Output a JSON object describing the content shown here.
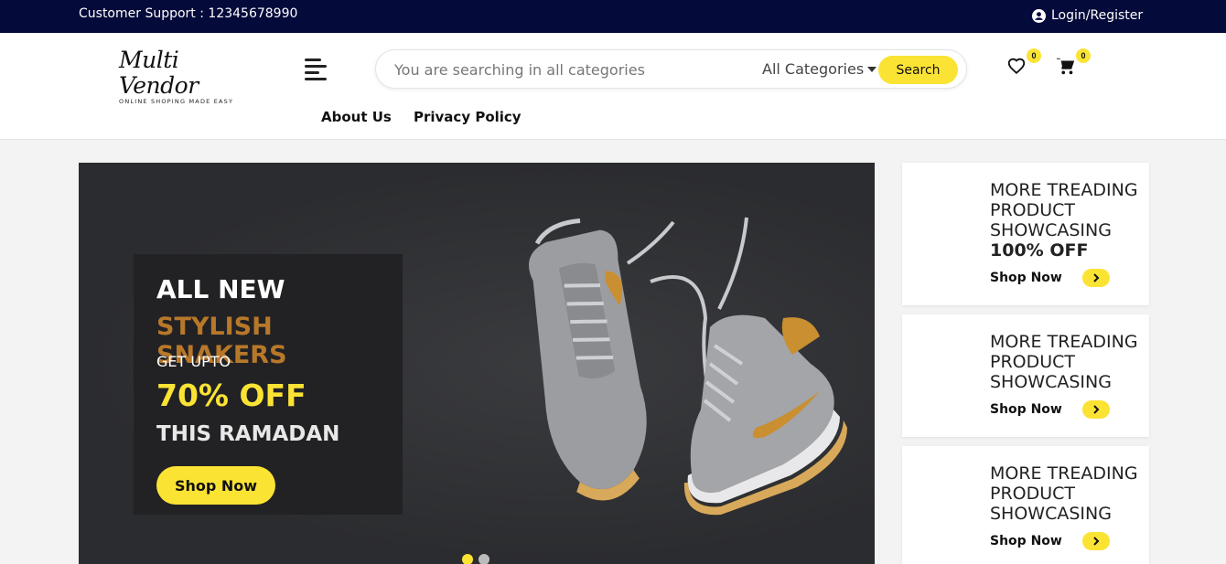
{
  "topbar": {
    "support": "Customer Support : 12345678990",
    "login": "Login/Register"
  },
  "logo": {
    "name": "Multi Vendor",
    "tagline": "ONLINE SHOPING MADE EASY"
  },
  "search": {
    "placeholder": "You are searching in all categories",
    "category": "All Categories",
    "button": "Search"
  },
  "header_icons": {
    "wishlist_count": "0",
    "cart_count": "0"
  },
  "nav": {
    "about": "About Us",
    "privacy": "Privacy Policy"
  },
  "hero": {
    "line1": "ALL NEW",
    "line2": "STYLISH SNAKERS",
    "line3": "GET UPTO",
    "line4": "70% OFF",
    "line5": "THIS RAMADAN",
    "button": "Shop Now",
    "slide_count": 2,
    "active_slide": 1
  },
  "side_cards": [
    {
      "title": "MORE TREADING PRODUCT SHOWCASING",
      "offer": "100% OFF",
      "button": "Shop Now"
    },
    {
      "title": "MORE TREADING PRODUCT SHOWCASING",
      "offer": "",
      "button": "Shop Now"
    },
    {
      "title": "MORE TREADING PRODUCT SHOWCASING",
      "offer": "",
      "button": "Shop Now"
    }
  ],
  "colors": {
    "topbar": "#040a3a",
    "accent": "#fbe334",
    "hero_bg": "#2f3033",
    "highlight_text": "#b8782a"
  }
}
